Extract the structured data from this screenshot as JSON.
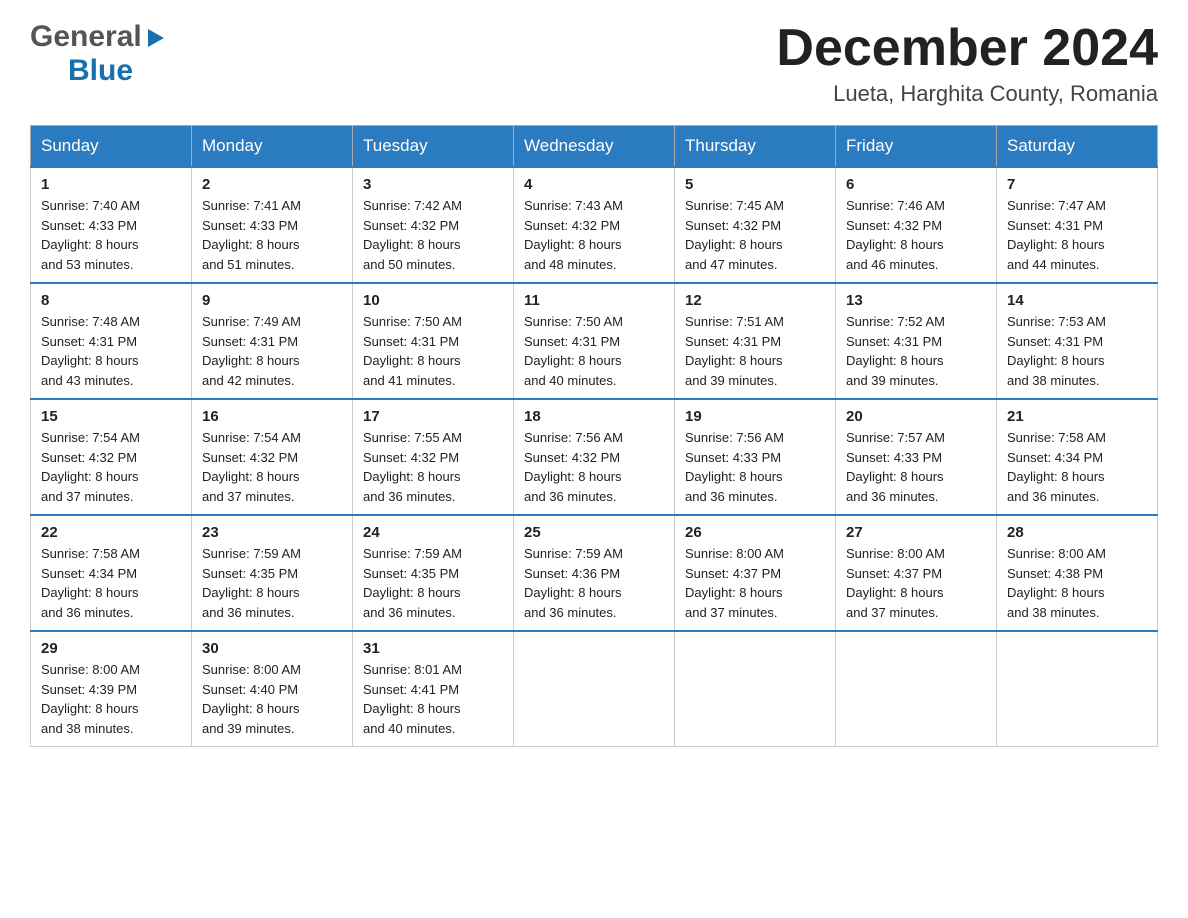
{
  "header": {
    "logo_general": "General",
    "logo_triangle": "▶",
    "logo_blue": "Blue",
    "month_title": "December 2024",
    "location": "Lueta, Harghita County, Romania"
  },
  "days_of_week": [
    "Sunday",
    "Monday",
    "Tuesday",
    "Wednesday",
    "Thursday",
    "Friday",
    "Saturday"
  ],
  "weeks": [
    [
      {
        "day": "1",
        "sunrise": "7:40 AM",
        "sunset": "4:33 PM",
        "daylight": "8 hours and 53 minutes."
      },
      {
        "day": "2",
        "sunrise": "7:41 AM",
        "sunset": "4:33 PM",
        "daylight": "8 hours and 51 minutes."
      },
      {
        "day": "3",
        "sunrise": "7:42 AM",
        "sunset": "4:32 PM",
        "daylight": "8 hours and 50 minutes."
      },
      {
        "day": "4",
        "sunrise": "7:43 AM",
        "sunset": "4:32 PM",
        "daylight": "8 hours and 48 minutes."
      },
      {
        "day": "5",
        "sunrise": "7:45 AM",
        "sunset": "4:32 PM",
        "daylight": "8 hours and 47 minutes."
      },
      {
        "day": "6",
        "sunrise": "7:46 AM",
        "sunset": "4:32 PM",
        "daylight": "8 hours and 46 minutes."
      },
      {
        "day": "7",
        "sunrise": "7:47 AM",
        "sunset": "4:31 PM",
        "daylight": "8 hours and 44 minutes."
      }
    ],
    [
      {
        "day": "8",
        "sunrise": "7:48 AM",
        "sunset": "4:31 PM",
        "daylight": "8 hours and 43 minutes."
      },
      {
        "day": "9",
        "sunrise": "7:49 AM",
        "sunset": "4:31 PM",
        "daylight": "8 hours and 42 minutes."
      },
      {
        "day": "10",
        "sunrise": "7:50 AM",
        "sunset": "4:31 PM",
        "daylight": "8 hours and 41 minutes."
      },
      {
        "day": "11",
        "sunrise": "7:50 AM",
        "sunset": "4:31 PM",
        "daylight": "8 hours and 40 minutes."
      },
      {
        "day": "12",
        "sunrise": "7:51 AM",
        "sunset": "4:31 PM",
        "daylight": "8 hours and 39 minutes."
      },
      {
        "day": "13",
        "sunrise": "7:52 AM",
        "sunset": "4:31 PM",
        "daylight": "8 hours and 39 minutes."
      },
      {
        "day": "14",
        "sunrise": "7:53 AM",
        "sunset": "4:31 PM",
        "daylight": "8 hours and 38 minutes."
      }
    ],
    [
      {
        "day": "15",
        "sunrise": "7:54 AM",
        "sunset": "4:32 PM",
        "daylight": "8 hours and 37 minutes."
      },
      {
        "day": "16",
        "sunrise": "7:54 AM",
        "sunset": "4:32 PM",
        "daylight": "8 hours and 37 minutes."
      },
      {
        "day": "17",
        "sunrise": "7:55 AM",
        "sunset": "4:32 PM",
        "daylight": "8 hours and 36 minutes."
      },
      {
        "day": "18",
        "sunrise": "7:56 AM",
        "sunset": "4:32 PM",
        "daylight": "8 hours and 36 minutes."
      },
      {
        "day": "19",
        "sunrise": "7:56 AM",
        "sunset": "4:33 PM",
        "daylight": "8 hours and 36 minutes."
      },
      {
        "day": "20",
        "sunrise": "7:57 AM",
        "sunset": "4:33 PM",
        "daylight": "8 hours and 36 minutes."
      },
      {
        "day": "21",
        "sunrise": "7:58 AM",
        "sunset": "4:34 PM",
        "daylight": "8 hours and 36 minutes."
      }
    ],
    [
      {
        "day": "22",
        "sunrise": "7:58 AM",
        "sunset": "4:34 PM",
        "daylight": "8 hours and 36 minutes."
      },
      {
        "day": "23",
        "sunrise": "7:59 AM",
        "sunset": "4:35 PM",
        "daylight": "8 hours and 36 minutes."
      },
      {
        "day": "24",
        "sunrise": "7:59 AM",
        "sunset": "4:35 PM",
        "daylight": "8 hours and 36 minutes."
      },
      {
        "day": "25",
        "sunrise": "7:59 AM",
        "sunset": "4:36 PM",
        "daylight": "8 hours and 36 minutes."
      },
      {
        "day": "26",
        "sunrise": "8:00 AM",
        "sunset": "4:37 PM",
        "daylight": "8 hours and 37 minutes."
      },
      {
        "day": "27",
        "sunrise": "8:00 AM",
        "sunset": "4:37 PM",
        "daylight": "8 hours and 37 minutes."
      },
      {
        "day": "28",
        "sunrise": "8:00 AM",
        "sunset": "4:38 PM",
        "daylight": "8 hours and 38 minutes."
      }
    ],
    [
      {
        "day": "29",
        "sunrise": "8:00 AM",
        "sunset": "4:39 PM",
        "daylight": "8 hours and 38 minutes."
      },
      {
        "day": "30",
        "sunrise": "8:00 AM",
        "sunset": "4:40 PM",
        "daylight": "8 hours and 39 minutes."
      },
      {
        "day": "31",
        "sunrise": "8:01 AM",
        "sunset": "4:41 PM",
        "daylight": "8 hours and 40 minutes."
      },
      null,
      null,
      null,
      null
    ]
  ],
  "labels": {
    "sunrise": "Sunrise:",
    "sunset": "Sunset:",
    "daylight": "Daylight:"
  }
}
